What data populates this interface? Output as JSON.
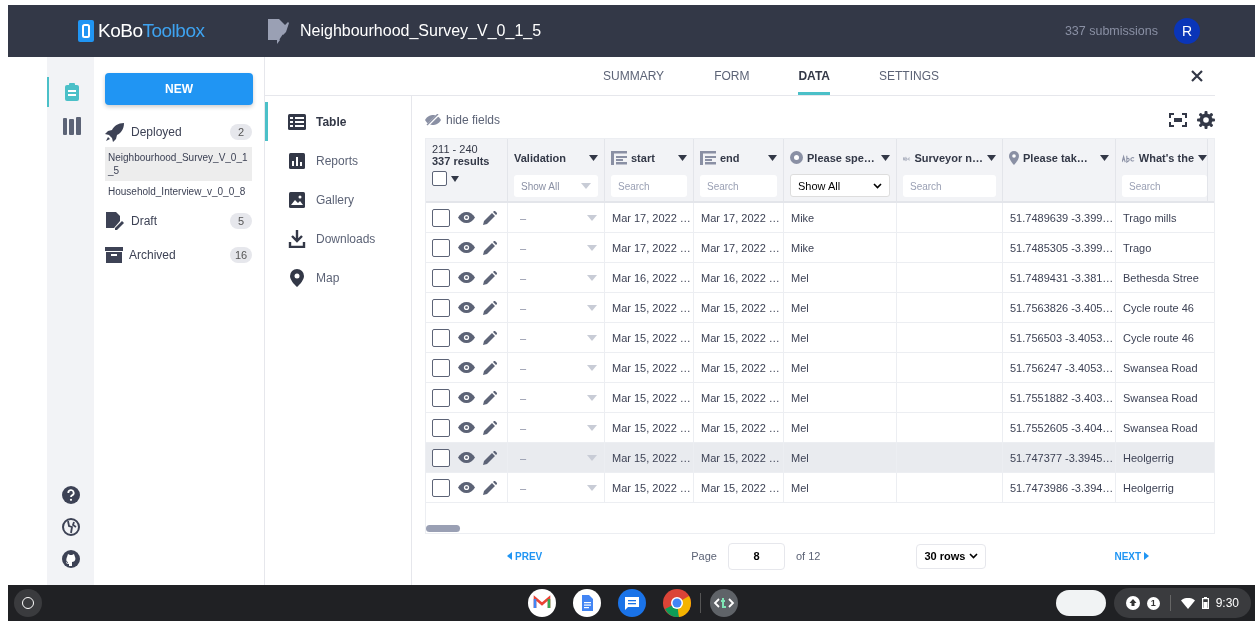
{
  "header": {
    "logo": {
      "first": "KoBo",
      "second": "Toolbox"
    },
    "form_title": "Neighbourhood_Survey_V_0_1_5",
    "submissions": "337 submissions",
    "avatar": "R"
  },
  "rail": {
    "items": [
      {
        "selected": true
      },
      {
        "selected": false
      }
    ]
  },
  "sidebar": {
    "new_button": "NEW",
    "groups": [
      {
        "label": "Deployed",
        "count": "2",
        "children": [
          {
            "label": "Neighbourhood_Survey_V_0_1_5",
            "selected": true
          },
          {
            "label": "Household_Interview_v_0_0_8",
            "selected": false
          }
        ]
      },
      {
        "label": "Draft",
        "count": "5"
      },
      {
        "label": "Archived",
        "count": "16"
      }
    ]
  },
  "tabs": [
    {
      "label": "SUMMARY",
      "selected": false
    },
    {
      "label": "FORM",
      "selected": false
    },
    {
      "label": "DATA",
      "selected": true
    },
    {
      "label": "SETTINGS",
      "selected": false
    }
  ],
  "subnav": [
    {
      "label": "Table",
      "selected": true
    },
    {
      "label": "Reports",
      "selected": false
    },
    {
      "label": "Gallery",
      "selected": false
    },
    {
      "label": "Downloads",
      "selected": false
    },
    {
      "label": "Map",
      "selected": false
    }
  ],
  "table": {
    "hide_fields": "hide fields",
    "range": "211 - 240",
    "results": "337 results",
    "select_all_checked": false,
    "columns": [
      {
        "label": "Validation",
        "kind": "none",
        "filter": {
          "kind": "pseudo-select",
          "text": "Show All"
        }
      },
      {
        "label": "start",
        "kind": "date",
        "filter": {
          "kind": "search",
          "placeholder": "Search"
        }
      },
      {
        "label": "end",
        "kind": "date",
        "filter": {
          "kind": "search",
          "placeholder": "Search"
        }
      },
      {
        "label": "Please spe…",
        "kind": "choice",
        "filter": {
          "kind": "select",
          "text": "Show All"
        }
      },
      {
        "label": "Surveyor n…",
        "kind": "text",
        "filter": {
          "kind": "search",
          "placeholder": "Search"
        }
      },
      {
        "label": "Please tak…",
        "kind": "geo"
      },
      {
        "label": "What's the",
        "kind": "text",
        "filter": {
          "kind": "search",
          "placeholder": "Search"
        }
      }
    ],
    "rows": [
      {
        "validation": "–",
        "start": "Mar 17, 2022 …",
        "end": "Mar 17, 2022 …",
        "speaker": "Mike",
        "location": "51.7489639 -3.399…",
        "answer": "Trago mills",
        "highlighted": false
      },
      {
        "validation": "–",
        "start": "Mar 17, 2022 …",
        "end": "Mar 17, 2022 …",
        "speaker": "Mike",
        "location": "51.7485305 -3.399…",
        "answer": "Trago",
        "highlighted": false
      },
      {
        "validation": "–",
        "start": "Mar 16, 2022 …",
        "end": "Mar 16, 2022 …",
        "speaker": "Mel",
        "location": "51.7489431 -3.381…",
        "answer": "Bethesda Stree",
        "highlighted": false
      },
      {
        "validation": "–",
        "start": "Mar 15, 2022 …",
        "end": "Mar 15, 2022 …",
        "speaker": "Mel",
        "location": "51.7563826 -3.405…",
        "answer": "Cycle route 46",
        "highlighted": false
      },
      {
        "validation": "–",
        "start": "Mar 15, 2022 …",
        "end": "Mar 15, 2022 …",
        "speaker": "Mel",
        "location": "51.756503 -3.4053…",
        "answer": "Cycle route 46",
        "highlighted": false
      },
      {
        "validation": "–",
        "start": "Mar 15, 2022 …",
        "end": "Mar 15, 2022 …",
        "speaker": "Mel",
        "location": "51.756247 -3.4053…",
        "answer": "Swansea Road",
        "highlighted": false
      },
      {
        "validation": "–",
        "start": "Mar 15, 2022 …",
        "end": "Mar 15, 2022 …",
        "speaker": "Mel",
        "location": "51.7551882 -3.403…",
        "answer": "Swansea Road",
        "highlighted": false
      },
      {
        "validation": "–",
        "start": "Mar 15, 2022 …",
        "end": "Mar 15, 2022 …",
        "speaker": "Mel",
        "location": "51.7552605 -3.404…",
        "answer": "Swansea Road",
        "highlighted": false
      },
      {
        "validation": "–",
        "start": "Mar 15, 2022 …",
        "end": "Mar 15, 2022 …",
        "speaker": "Mel",
        "location": "51.747377 -3.3945…",
        "answer": "Heolgerrig",
        "highlighted": true
      },
      {
        "validation": "–",
        "start": "Mar 15, 2022 …",
        "end": "Mar 15, 2022 …",
        "speaker": "Mel",
        "location": "51.7473986 -3.394…",
        "answer": "Heolgerrig",
        "highlighted": false
      }
    ]
  },
  "pagination": {
    "prev": "PREV",
    "page_label": "Page",
    "page": "8",
    "of": "of 12",
    "rows": "30 rows",
    "next": "NEXT"
  },
  "taskbar": {
    "notification_count": "1",
    "time": "9:30"
  }
}
